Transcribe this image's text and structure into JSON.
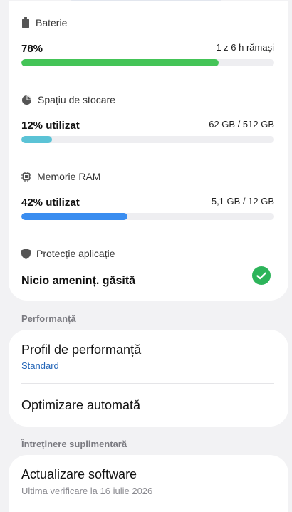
{
  "battery": {
    "label": "Baterie",
    "percent": "78%",
    "remaining": "1 z 6 h rămași",
    "level": 0.78,
    "color": "#44c457"
  },
  "storage": {
    "label": "Spațiu de stocare",
    "used_label": "12% utilizat",
    "amount": "62 GB / 512 GB",
    "level": 0.12,
    "color": "#5bc3d6"
  },
  "ram": {
    "label": "Memorie RAM",
    "used_label": "42% utilizat",
    "amount": "5,1 GB / 12 GB",
    "level": 0.42,
    "color": "#3a8df0"
  },
  "protection": {
    "label": "Protecție aplicație",
    "status": "Nicio ameninț. găsită",
    "status_color": "#2db45a"
  },
  "performance": {
    "group_label": "Performanță",
    "profile_title": "Profil de performanță",
    "profile_value": "Standard",
    "profile_value_color": "#2466b8",
    "auto_opt_title": "Optimizare automată"
  },
  "maintenance": {
    "group_label": "Întreținere suplimentară",
    "software_title": "Actualizare software",
    "software_sub": "Ultima verificare la 16 iulie 2026"
  }
}
